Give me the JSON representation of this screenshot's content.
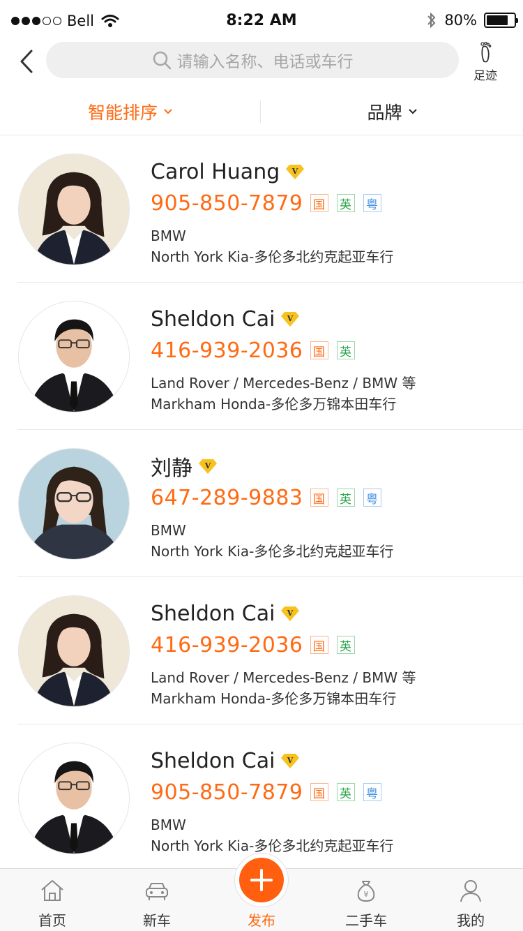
{
  "status_bar": {
    "carrier": "Bell",
    "time": "8:22 AM",
    "battery": "80%",
    "battery_level": 0.8
  },
  "header": {
    "search_placeholder": "请输入名称、电话或车行",
    "footprint_label": "足迹"
  },
  "filters": {
    "sort_label": "智能排序",
    "brand_label": "品牌"
  },
  "colors": {
    "accent": "#ff6a13",
    "lang_guo": "#ff6a13",
    "lang_ying": "#2aa44a",
    "lang_yue": "#3f8fe0",
    "vip": "#f7c21e"
  },
  "lang_tags": {
    "guo": "国",
    "ying": "英",
    "yue": "粤"
  },
  "salespeople": [
    {
      "name": "Carol Huang",
      "phone": "905-850-7879",
      "brands": "BMW",
      "dealer": "North York Kia-多伦多北约克起亚车行"
    },
    {
      "name": "Sheldon Cai",
      "phone": "416-939-2036",
      "brands": "Land Rover / Mercedes-Benz / BMW 等",
      "dealer": "Markham Honda-多伦多万锦本田车行"
    },
    {
      "name": "刘静",
      "phone": "647-289-9883",
      "brands": "BMW",
      "dealer": "North York Kia-多伦多北约克起亚车行"
    },
    {
      "name": "Sheldon Cai",
      "phone": "416-939-2036",
      "brands": "Land Rover / Mercedes-Benz / BMW 等",
      "dealer": "Markham Honda-多伦多万锦本田车行"
    },
    {
      "name": "Sheldon Cai",
      "phone": "905-850-7879",
      "brands": "BMW",
      "dealer": "North York Kia-多伦多北约克起亚车行"
    }
  ],
  "tabbar": {
    "home": "首页",
    "new_car": "新车",
    "publish": "发布",
    "used_car": "二手车",
    "mine": "我的"
  }
}
